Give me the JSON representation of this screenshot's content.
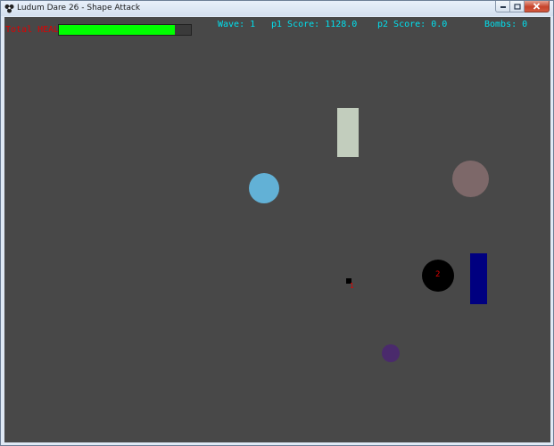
{
  "window": {
    "title": "Ludum Dare 26 - Shape Attack",
    "icon": "app-icon"
  },
  "hud": {
    "health_label": "Total HEALTH",
    "health_fraction": 0.88,
    "wave_text": "Wave: 1",
    "p1_score_text": "p1 Score: 1128.0",
    "p2_score_text": "p2 Score: 0.0",
    "bombs_text": "Bombs: 0"
  },
  "colors": {
    "background": "#484848",
    "hud_text": "#00e0ee",
    "health_label": "#e00000",
    "health_fill": "#00ff00",
    "rect_pale": "#c2cdbd",
    "circle_blue": "#62b1d6",
    "circle_mauve": "#7d6869",
    "player_circle": "#000000",
    "rect_navy": "#000080",
    "circle_purple": "#4a2a6c",
    "player_marker": "#000000"
  },
  "entities": {
    "player2_label": "2",
    "player1_label": "1"
  }
}
